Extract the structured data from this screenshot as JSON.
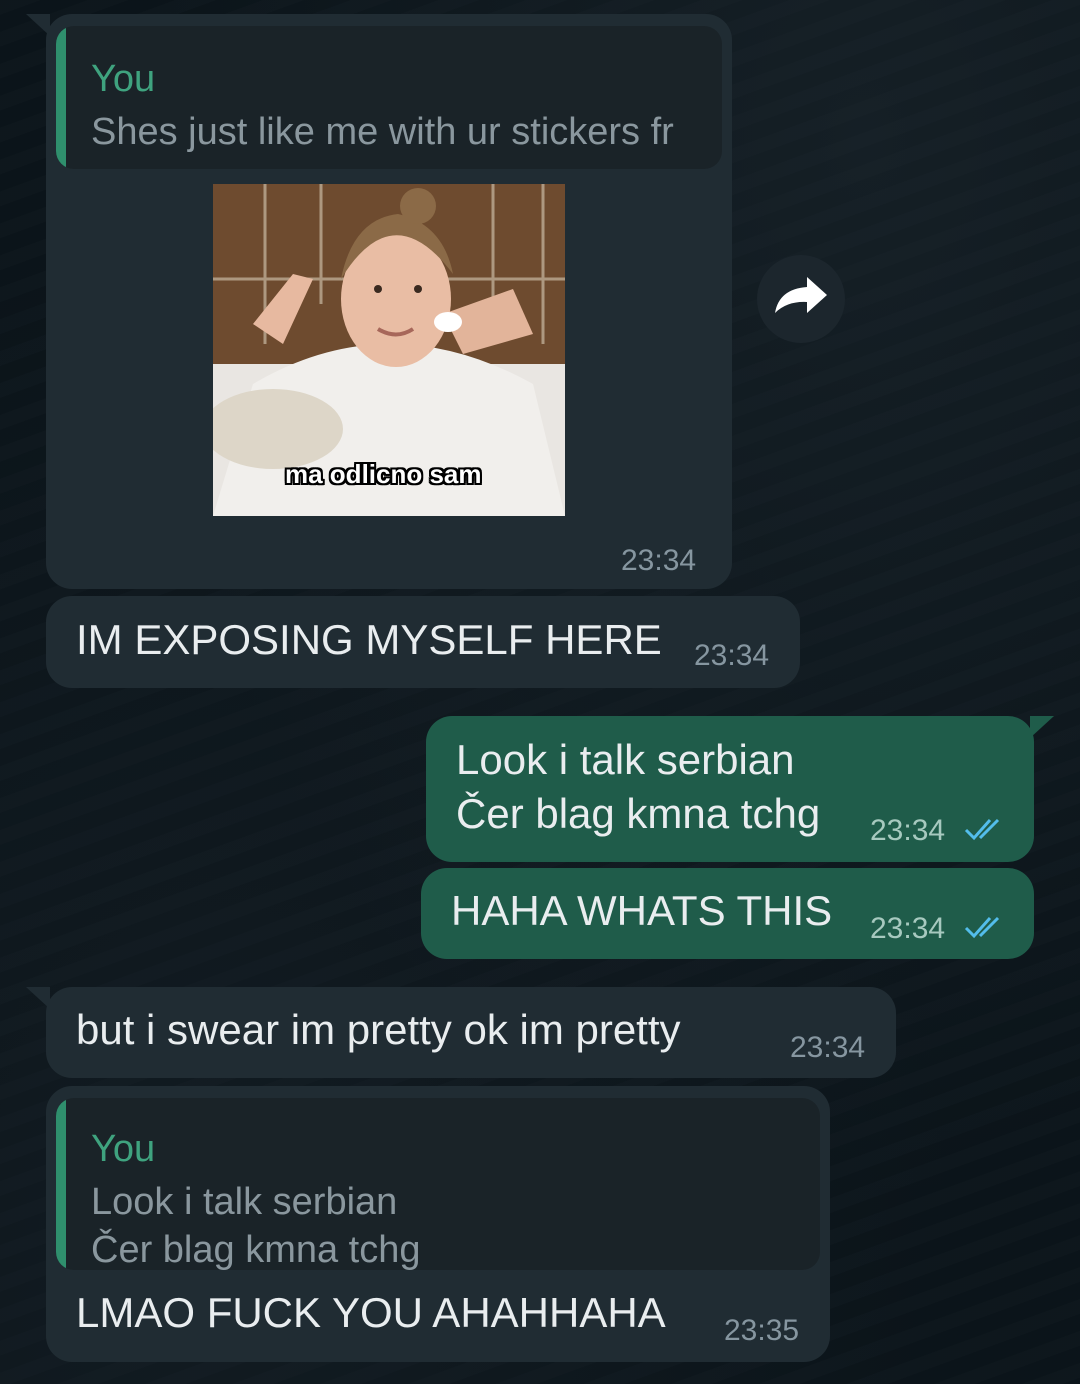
{
  "messages": [
    {
      "id": "m1",
      "direction": "incoming",
      "quote": {
        "author": "You",
        "text": "Shes just like me with ur stickers fr"
      },
      "sticker": {
        "caption": "ma odlicno sam"
      },
      "time": "23:34"
    },
    {
      "id": "m2",
      "direction": "incoming",
      "text": "IM EXPOSING MYSELF HERE",
      "time": "23:34"
    },
    {
      "id": "m3",
      "direction": "outgoing",
      "text": "Look i talk serbian\nČer blag kmna tchg",
      "time": "23:34",
      "status": "read"
    },
    {
      "id": "m4",
      "direction": "outgoing",
      "text": "HAHA WHATS THIS",
      "time": "23:34",
      "status": "read"
    },
    {
      "id": "m5",
      "direction": "incoming",
      "text": "but i swear im pretty ok im pretty",
      "time": "23:34"
    },
    {
      "id": "m6",
      "direction": "incoming",
      "quote": {
        "author": "You",
        "text": "Look i talk serbian\nČer blag kmna tchg"
      },
      "text": "LMAO FUCK YOU AHAHHAHA",
      "time": "23:35"
    }
  ],
  "icons": {
    "forward": "forward-arrow-icon",
    "read": "double-check-icon"
  },
  "colors": {
    "incoming_bubble": "#202c33",
    "outgoing_bubble": "#1f5c4a",
    "quote_bar": "#2f8f6d",
    "read_tick": "#53bdeb"
  }
}
